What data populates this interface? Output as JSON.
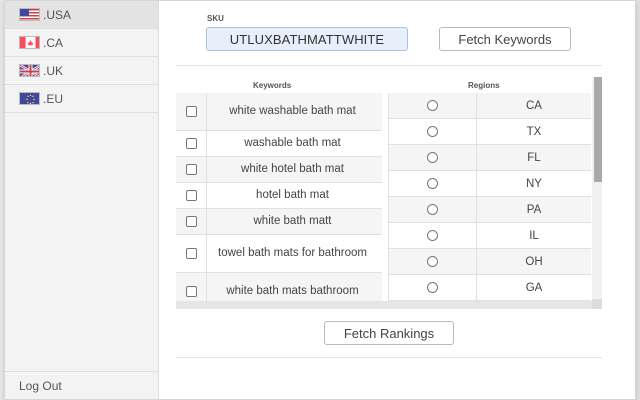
{
  "sidebar": {
    "stores": [
      {
        "label": ".USA",
        "flag": "us-flag",
        "active": true
      },
      {
        "label": ".CA",
        "flag": "ca-flag",
        "active": false
      },
      {
        "label": ".UK",
        "flag": "uk-flag",
        "active": false
      },
      {
        "label": ".EU",
        "flag": "eu-flag",
        "active": false
      }
    ],
    "logout_label": "Log Out"
  },
  "sku": {
    "label": "SKU",
    "value": "UTLUXBATHMATTWHITE"
  },
  "fetch_keywords_label": "Fetch Keywords",
  "fetch_rankings_label": "Fetch Rankings",
  "keywords": {
    "header": "Keywords",
    "rows": [
      "white washable bath mat",
      "washable bath mat",
      "white hotel bath mat",
      "hotel bath mat",
      "white bath matt",
      "towel bath mats for bathroom",
      "white bath mats bathroom"
    ]
  },
  "regions": {
    "header": "Regions",
    "rows": [
      "CA",
      "TX",
      "FL",
      "NY",
      "PA",
      "IL",
      "OH",
      "GA"
    ]
  },
  "colors": {
    "sku_bg": "#e6effa",
    "sidebar_bg": "#f3f3f3",
    "active_store_bg": "#e3e3e3"
  }
}
